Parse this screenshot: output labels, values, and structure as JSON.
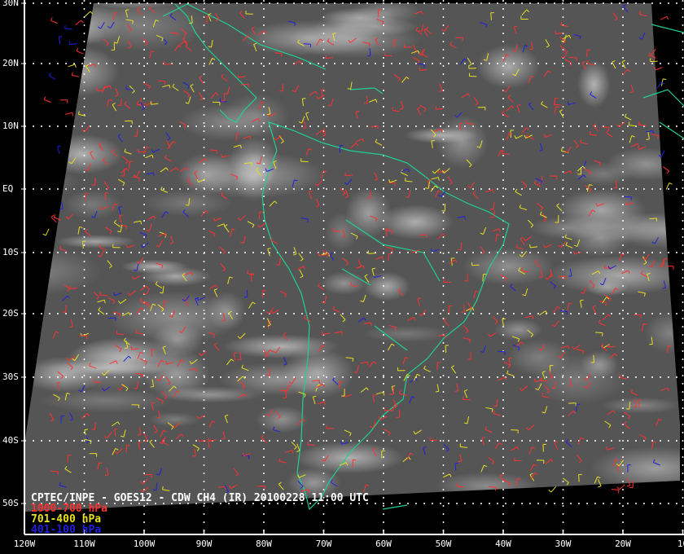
{
  "title": "CPTEC/INPE - GOES12 - CDW CH4 (IR) 20100228 11:00 UTC",
  "legend": [
    {
      "label": "1000-700 hPa",
      "color": "#ff3030"
    },
    {
      "label": "701-400 hPa",
      "color": "#e8e020"
    },
    {
      "label": "401-100 hPa",
      "color": "#2020e0"
    }
  ],
  "lat_labels": [
    "30N",
    "20N",
    "10N",
    "EQ",
    "10S",
    "20S",
    "30S",
    "40S",
    "50S"
  ],
  "lon_labels": [
    "120W",
    "110W",
    "100W",
    "90W",
    "80W",
    "70W",
    "60W",
    "50W",
    "40W",
    "30W",
    "20W",
    "10"
  ],
  "colors": {
    "coast": "#20d090",
    "grid": "#ffffff",
    "background": "#000000"
  }
}
